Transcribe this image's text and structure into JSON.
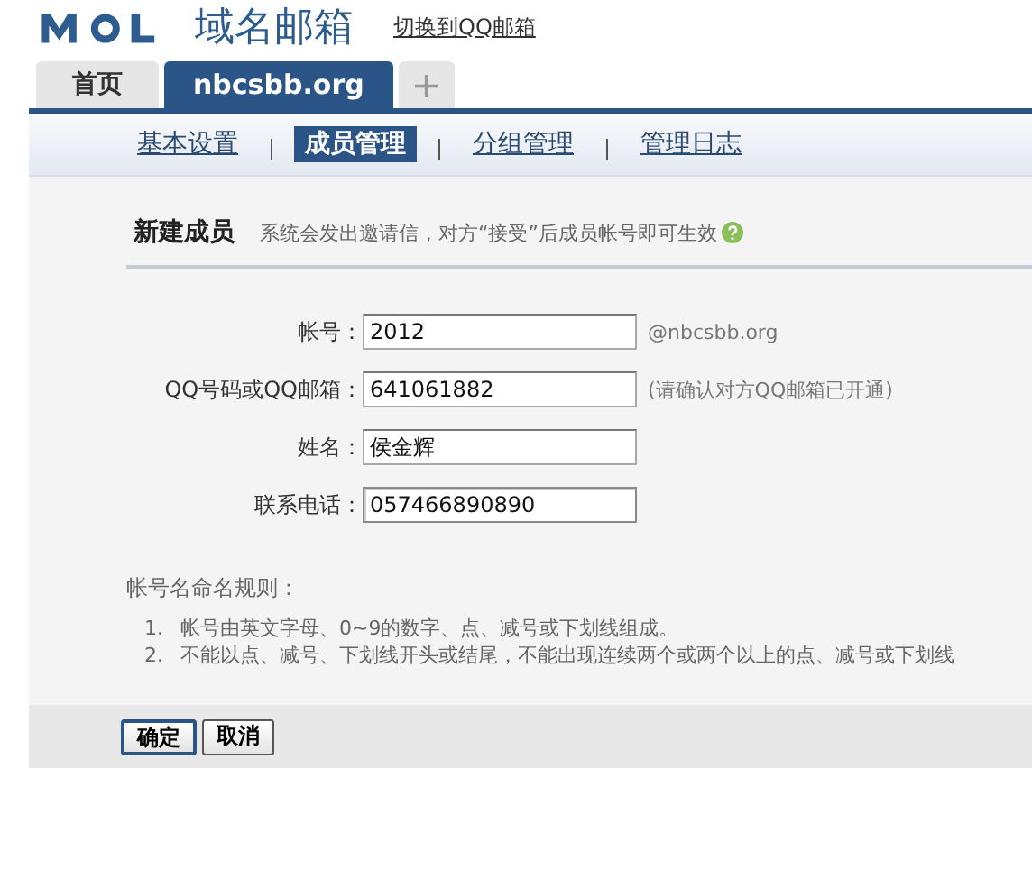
{
  "header": {
    "title": "域名邮箱",
    "switch_link": "切换到QQ邮箱"
  },
  "tabs": [
    {
      "label": "首页",
      "selected": false
    },
    {
      "label": "nbcsbb.org",
      "selected": true
    },
    {
      "label": "+",
      "kind": "add",
      "selected": false
    }
  ],
  "subnav": [
    {
      "label": "基本设置",
      "selected": false
    },
    {
      "label": "成员管理",
      "selected": true
    },
    {
      "label": "分组管理",
      "selected": false
    },
    {
      "label": "管理日志",
      "selected": false
    }
  ],
  "section": {
    "title": "新建成员",
    "hint": "系统会发出邀请信，对方“接受”后成员帐号即可生效"
  },
  "fields": [
    {
      "label": "帐号：",
      "value": "2012",
      "note": "@nbcsbb.org",
      "focused": false
    },
    {
      "label": "QQ号码或QQ邮箱：",
      "value": "641061882",
      "note": "(请确认对方QQ邮箱已开通)",
      "focused": false
    },
    {
      "label": "姓名：",
      "value": "侯金辉",
      "focused": false
    },
    {
      "label": "联系电话：",
      "value": "057466890890",
      "focused": true
    }
  ],
  "rules": {
    "title": "帐号名命名规则：",
    "items": [
      {
        "number": "1.",
        "text": "帐号由英文字母、0~9的数字、点、减号或下划线组成。"
      },
      {
        "number": "2.",
        "text": "不能以点、减号、下划线开头或结尾，不能出现连续两个或两个以上的点、减号或下划线"
      }
    ]
  },
  "buttons": [
    "确定",
    "取消"
  ]
}
